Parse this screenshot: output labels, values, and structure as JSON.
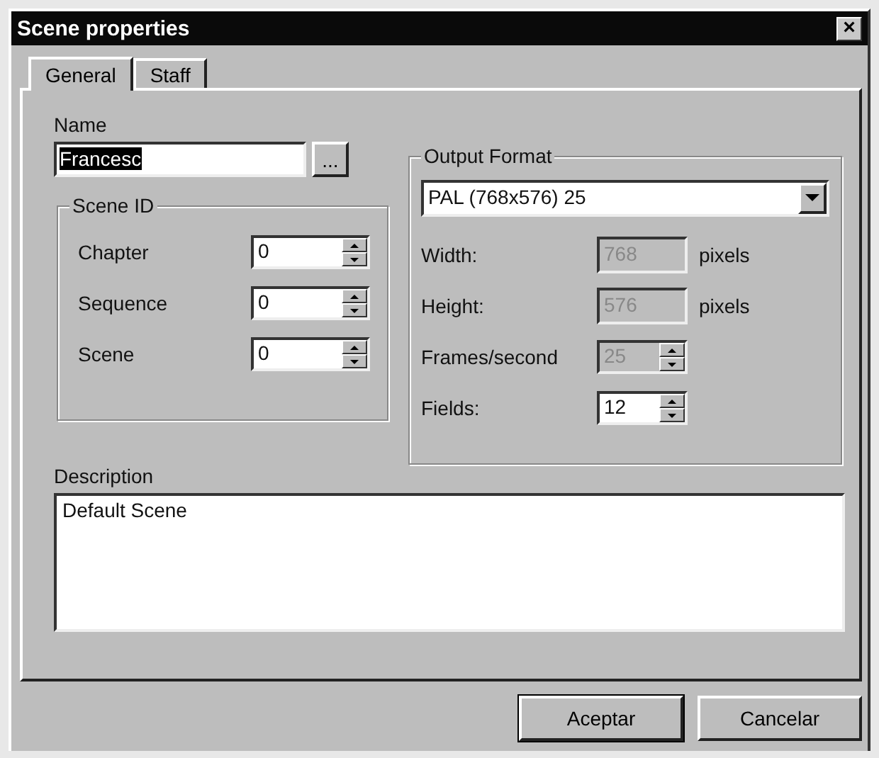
{
  "window": {
    "title": "Scene properties",
    "close": "×"
  },
  "tabs": [
    {
      "label": "General",
      "selected": true
    },
    {
      "label": "Staff",
      "selected": false
    }
  ],
  "name": {
    "label": "Name",
    "value": "Francesc",
    "text_selected": true,
    "browse": "..."
  },
  "scene_id": {
    "title": "Scene ID",
    "fields": [
      {
        "label": "Chapter",
        "value": "0"
      },
      {
        "label": "Sequence",
        "value": "0"
      },
      {
        "label": "Scene",
        "value": "0"
      }
    ]
  },
  "output_format": {
    "title": "Output Format",
    "format": "PAL (768x576) 25",
    "fields": [
      {
        "kind": "text",
        "label": "Width:",
        "value": "768",
        "unit": "pixels",
        "disabled": true
      },
      {
        "kind": "text",
        "label": "Height:",
        "value": "576",
        "unit": "pixels",
        "disabled": true
      },
      {
        "kind": "spin",
        "label": "Frames/second",
        "value": "25",
        "disabled": true
      },
      {
        "kind": "spin",
        "label": "Fields:",
        "value": "12",
        "disabled": false
      }
    ]
  },
  "description": {
    "label": "Description",
    "value": "Default Scene"
  },
  "buttons": [
    {
      "label": "Aceptar",
      "default": true
    },
    {
      "label": "Cancelar",
      "default": false
    }
  ]
}
